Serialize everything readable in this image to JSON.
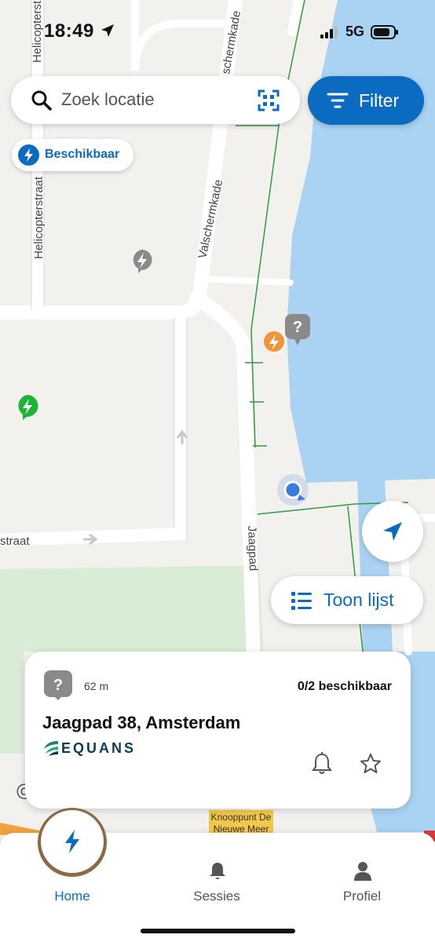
{
  "status": {
    "time": "18:49",
    "network": "5G"
  },
  "search": {
    "placeholder": "Zoek locatie",
    "filter_label": "Filter"
  },
  "chip": {
    "label": "Beschikbaar"
  },
  "map": {
    "streets": [
      "Helicopterstraat",
      "Valschermkade",
      "Jaagpad",
      "straat",
      "schermkade"
    ],
    "poi": {
      "line1": "Knooppunt De",
      "line2": "Nieuwe Meer"
    }
  },
  "list_button": {
    "label": "Toon lijst"
  },
  "card": {
    "distance": "62 m",
    "availability": "0/2 beschikbaar",
    "title": "Jaagpad 38, Amsterdam",
    "operator": "EQUANS",
    "badge": "?"
  },
  "tabs": [
    {
      "label": "Home",
      "icon": "bolt-icon",
      "active": true
    },
    {
      "label": "Sessies",
      "icon": "bell-icon",
      "active": false
    },
    {
      "label": "Profiel",
      "icon": "person-icon",
      "active": false
    }
  ],
  "colors": {
    "accent": "#0a6bc0",
    "water": "#aad3f3",
    "park": "#d9ecd6",
    "available": "#1fb33a",
    "busy": "#f0953a",
    "unknown": "#8a8a8a"
  }
}
